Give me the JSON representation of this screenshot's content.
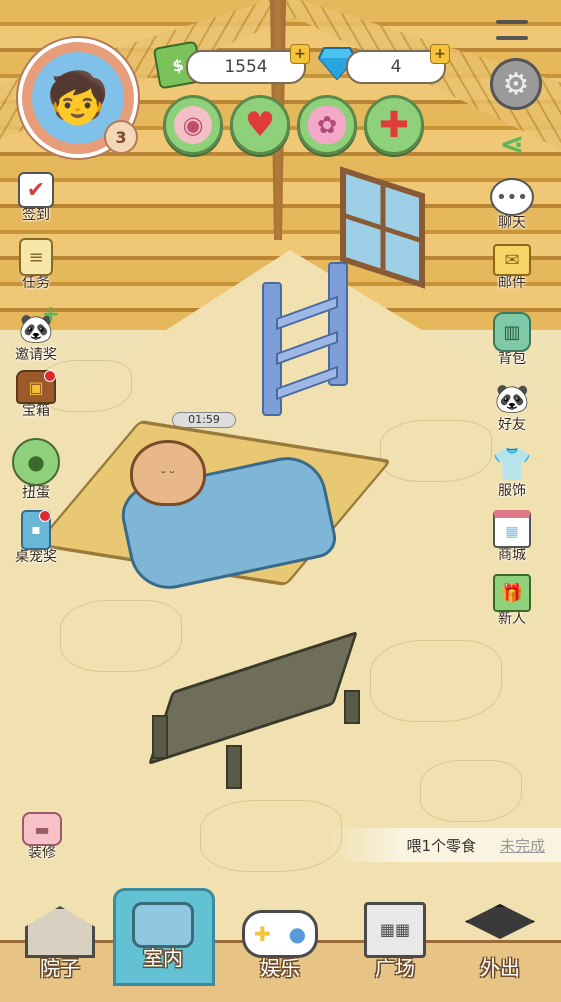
{
  "player": {
    "level": "3"
  },
  "currency": {
    "coins": "1554",
    "gems": "4",
    "plus_symbol": "+"
  },
  "stats": [
    {
      "icon": "meat-icon",
      "color": "#c0506a"
    },
    {
      "icon": "heart-icon",
      "color": "#e03a3a"
    },
    {
      "icon": "brain-icon",
      "color": "#e680a8"
    },
    {
      "icon": "health-cross-icon",
      "color": "#e03a3a"
    }
  ],
  "timer": "01:59",
  "left_menu": {
    "checkin": "签到",
    "tasks": "任务",
    "invite": "邀请奖",
    "chest": "宝箱",
    "gacha": "扭蛋",
    "desktop_pet": "桌宠奖",
    "decorate": "装修"
  },
  "right_menu": {
    "chat": "聊天",
    "mail": "邮件",
    "backpack": "背包",
    "friends": "好友",
    "clothing": "服饰",
    "shop": "商城",
    "newbie": "新人"
  },
  "task": {
    "text": "喂1个零食",
    "status": "未完成"
  },
  "bottom_nav": {
    "yard": "院子",
    "indoor": "室内",
    "entertainment": "娱乐",
    "plaza": "广场",
    "outing": "外出",
    "active": "indoor"
  },
  "colors": {
    "accent_blue": "#62c2d4",
    "stat_green": "#8fd07a",
    "notification_red": "#e02a2a"
  }
}
